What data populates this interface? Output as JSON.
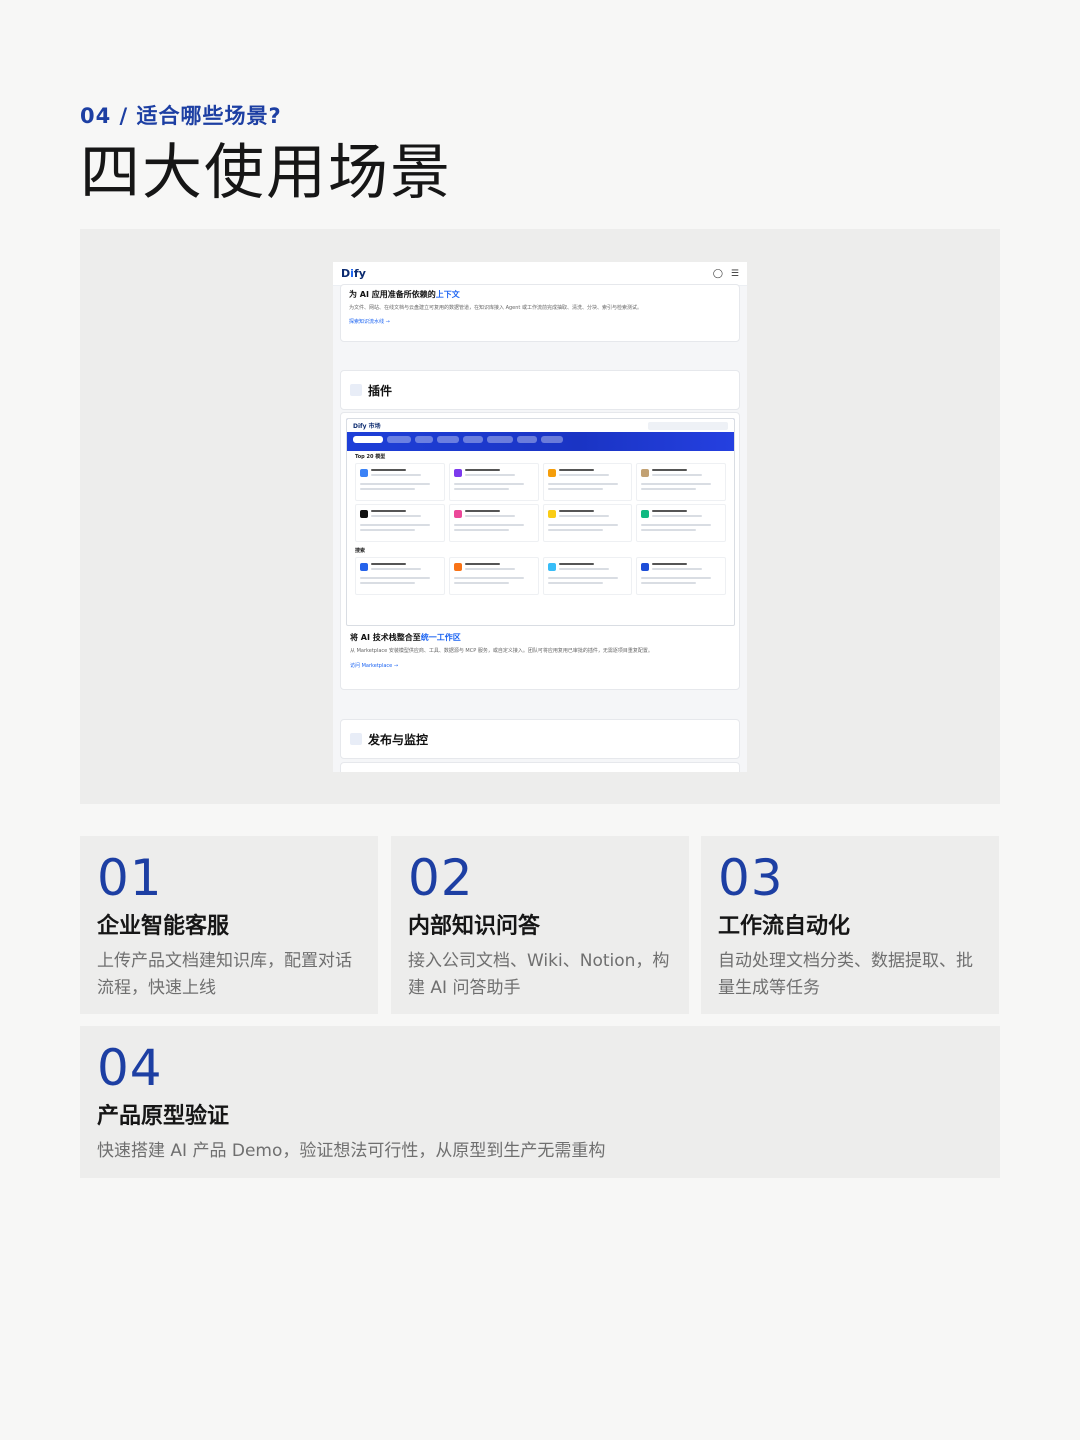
{
  "kicker": "04 / 适合哪些场景?",
  "headline": "四大使用场景",
  "screenshot": {
    "logo": "Dify",
    "header_icons": [
      "globe-icon",
      "menu-icon"
    ],
    "context_card": {
      "title_prefix": "为 AI 应用准备所依赖的",
      "title_highlight": "上下文",
      "desc": "为文件、网站、在线文档与云盘建立可复用的数据管道，在知识库接入 Agent 或工作流前完成抽取、清洗、分块、索引与检索测试。",
      "link": "探索知识流水线 →"
    },
    "plugins_label": "插件",
    "marketplace": {
      "title": "Dify 市场",
      "featured_heading": "Top 20 模型",
      "search_heading": "搜索"
    },
    "integrate_card": {
      "title_prefix": "将 AI 技术栈整合至",
      "title_highlight": "统一工作区",
      "desc": "从 Marketplace 安装模型供应商、工具、数据源与 MCP 服务，或自定义接入。团队可将应用复用已审批的插件，无需逐项目重复配置。",
      "link": "访问 Marketplace →"
    },
    "publish_label": "发布与监控"
  },
  "scenarios": [
    {
      "num": "01",
      "title": "企业智能客服",
      "desc": "上传产品文档建知识库，配置对话流程，快速上线"
    },
    {
      "num": "02",
      "title": "内部知识问答",
      "desc": "接入公司文档、Wiki、Notion，构建 AI 问答助手"
    },
    {
      "num": "03",
      "title": "工作流自动化",
      "desc": "自动处理文档分类、数据提取、批量生成等任务"
    },
    {
      "num": "04",
      "title": "产品原型验证",
      "desc": "快速搭建 AI 产品 Demo，验证想法可行性，从原型到生产无需重构"
    }
  ],
  "colors": {
    "accent": "#1d3fa3",
    "link": "#1c64f2",
    "panel": "#ededec"
  }
}
